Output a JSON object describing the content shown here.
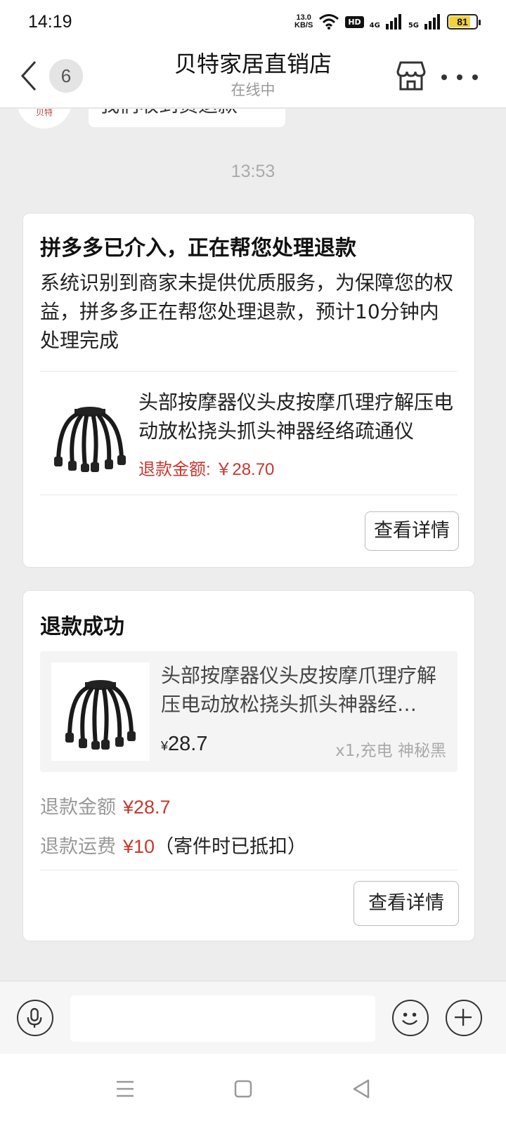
{
  "status_bar": {
    "time": "14:19",
    "net_speed_value": "13.0",
    "net_speed_unit": "KB/S",
    "hd_badge": "HD",
    "signal_1": "4G",
    "signal_2": "5G",
    "battery_level": 81,
    "battery_text": "81"
  },
  "header": {
    "unread_count": "6",
    "title": "贝特家居直销店",
    "subtitle": "在线中",
    "icons": [
      "back-chevron-icon",
      "store-icon",
      "more-dots-icon"
    ]
  },
  "chat": {
    "previous_message": "我们收到货退款",
    "avatar_text": "贝特",
    "timestamp": "13:53",
    "intervention_card": {
      "title": "拼多多已介入，正在帮您处理退款",
      "description": "系统识别到商家未提供优质服务，为保障您的权益，拼多多正在帮您处理退款，预计10分钟内处理完成",
      "product_name": "头部按摩器仪头皮按摩爪理疗解压电动放松挠头抓头神器经络疏通仪",
      "refund_label": "退款金额: ",
      "refund_amount": "￥28.70",
      "detail_button": "查看详情"
    },
    "refund_card": {
      "title": "退款成功",
      "product_name": "头部按摩器仪头皮按摩爪理疗解压电动放松挠头抓头神器经…",
      "price_currency": "¥",
      "price_value": "28.7",
      "spec": "x1,充电 神秘黑",
      "refund_amount_label": "退款金额",
      "refund_amount_value": "¥28.7",
      "refund_shipping_label": "退款运费",
      "refund_shipping_value": "¥10",
      "refund_shipping_note": "（寄件时已抵扣）",
      "detail_button": "查看详情"
    }
  },
  "input_bar": {
    "placeholder": "",
    "icons": [
      "microphone-icon",
      "emoji-icon",
      "plus-icon"
    ]
  },
  "system_nav": {
    "icons": [
      "menu-icon",
      "home-square-icon",
      "back-triangle-icon"
    ]
  },
  "colors": {
    "price_red": "#c8372d",
    "background": "#ededed",
    "card": "#ffffff",
    "battery_fill": "#f2d13a"
  }
}
